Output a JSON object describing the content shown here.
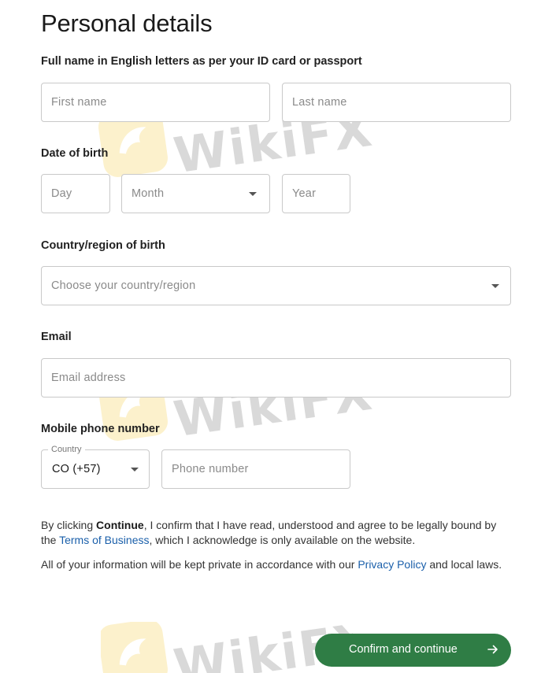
{
  "page": {
    "title": "Personal details"
  },
  "name_section": {
    "label": "Full name in English letters as per your ID card or passport",
    "first_name_placeholder": "First name",
    "last_name_placeholder": "Last name"
  },
  "dob_section": {
    "label": "Date of birth",
    "day_placeholder": "Day",
    "month_placeholder": "Month",
    "year_placeholder": "Year"
  },
  "country_section": {
    "label": "Country/region of birth",
    "placeholder": "Choose your country/region"
  },
  "email_section": {
    "label": "Email",
    "placeholder": "Email address"
  },
  "phone_section": {
    "label": "Mobile phone number",
    "country_label": "Country",
    "country_value": "CO (+57)",
    "number_placeholder": "Phone number"
  },
  "consent": {
    "prefix": "By clicking ",
    "continue_word": "Continue",
    "middle": ", I confirm that I have read, understood and agree to be legally bound by the ",
    "terms_link": "Terms of Business",
    "suffix": ", which I acknowledge is only available on the website."
  },
  "privacy": {
    "prefix": "All of your information will be kept private in accordance with our ",
    "policy_link": "Privacy Policy",
    "suffix": " and local laws."
  },
  "actions": {
    "confirm_label": "Confirm and continue"
  },
  "watermark": {
    "text": "WikiFX"
  },
  "colors": {
    "primary_button": "#2f7d45",
    "link": "#1a5faa",
    "border": "#c9c9c9"
  }
}
